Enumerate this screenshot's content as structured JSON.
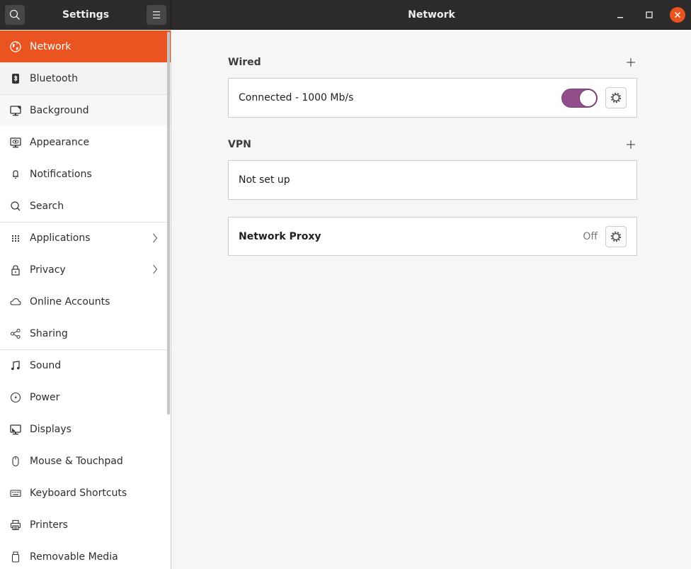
{
  "window": {
    "sidebar_title": "Settings",
    "page_title": "Network",
    "controls": [
      "minimize",
      "maximize",
      "close"
    ]
  },
  "colors": {
    "accent": "#e95420",
    "toggle_on": "#924d8b",
    "headerbar": "#2c2a2b"
  },
  "sidebar": {
    "items": [
      {
        "label": "Network",
        "icon": "globe-icon",
        "active": true
      },
      {
        "label": "Bluetooth",
        "icon": "bluetooth-icon"
      },
      {
        "label": "Background",
        "icon": "background-icon"
      },
      {
        "label": "Appearance",
        "icon": "appearance-icon"
      },
      {
        "label": "Notifications",
        "icon": "bell-icon"
      },
      {
        "label": "Search",
        "icon": "search-icon"
      },
      {
        "label": "Applications",
        "icon": "grid-icon",
        "has_submenu": true
      },
      {
        "label": "Privacy",
        "icon": "lock-icon",
        "has_submenu": true
      },
      {
        "label": "Online Accounts",
        "icon": "cloud-icon"
      },
      {
        "label": "Sharing",
        "icon": "share-icon"
      },
      {
        "label": "Sound",
        "icon": "music-note-icon"
      },
      {
        "label": "Power",
        "icon": "power-icon"
      },
      {
        "label": "Displays",
        "icon": "display-icon"
      },
      {
        "label": "Mouse & Touchpad",
        "icon": "mouse-icon"
      },
      {
        "label": "Keyboard Shortcuts",
        "icon": "keyboard-icon"
      },
      {
        "label": "Printers",
        "icon": "printer-icon"
      },
      {
        "label": "Removable Media",
        "icon": "usb-drive-icon"
      }
    ]
  },
  "main": {
    "wired": {
      "title": "Wired",
      "status": "Connected - 1000 Mb/s",
      "enabled": true
    },
    "vpn": {
      "title": "VPN",
      "status": "Not set up"
    },
    "proxy": {
      "title": "Network Proxy",
      "status": "Off"
    }
  }
}
